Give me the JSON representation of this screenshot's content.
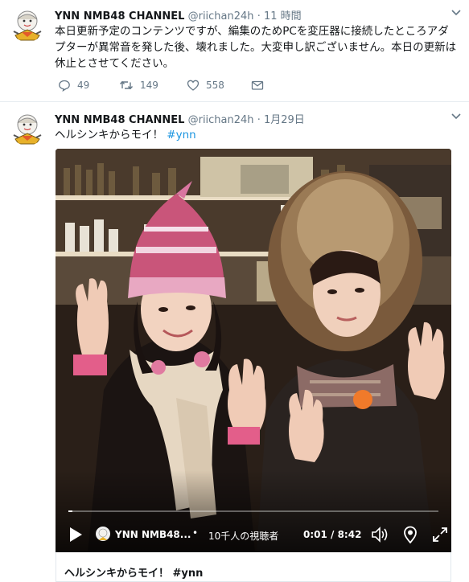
{
  "tweets": [
    {
      "name": "YNN NMB48 CHANNEL",
      "handle": "@riichan24h",
      "dot": "·",
      "time": "11 時間",
      "text": "本日更新予定のコンテンツですが、編集のためPCを変圧器に接続したところアダプターが異常音を発した後、壊れました。大変申し訳ございません。本日の更新は休止とさせてください。",
      "actions": {
        "reply": "49",
        "retweet": "149",
        "like": "558"
      }
    },
    {
      "name": "YNN NMB48 CHANNEL",
      "handle": "@riichan24h",
      "dot": "·",
      "time": "1月29日",
      "text": "ヘルシンキからモイ！",
      "hashtag": "#ynn",
      "video": {
        "channel": "YNN NMB48...",
        "separator": "•",
        "viewers": "10千人の視聴者",
        "timecode": "0:01 / 8:42",
        "progress": 0.002
      },
      "card_title": "ヘルシンキからモイ！ #ynn"
    }
  ],
  "icons": {
    "avatar": "mascot-avatar",
    "more": "chevron-down-icon",
    "reply": "reply-icon",
    "retweet": "retweet-icon",
    "like": "heart-icon",
    "dm": "envelope-icon",
    "play": "play-icon",
    "volume": "volume-icon",
    "pin": "location-pin-icon",
    "fullscreen": "fullscreen-icon"
  },
  "colors": {
    "link": "#1b95e0",
    "secondary": "#657786",
    "text": "#14171a",
    "divider": "#e6ecf0"
  }
}
